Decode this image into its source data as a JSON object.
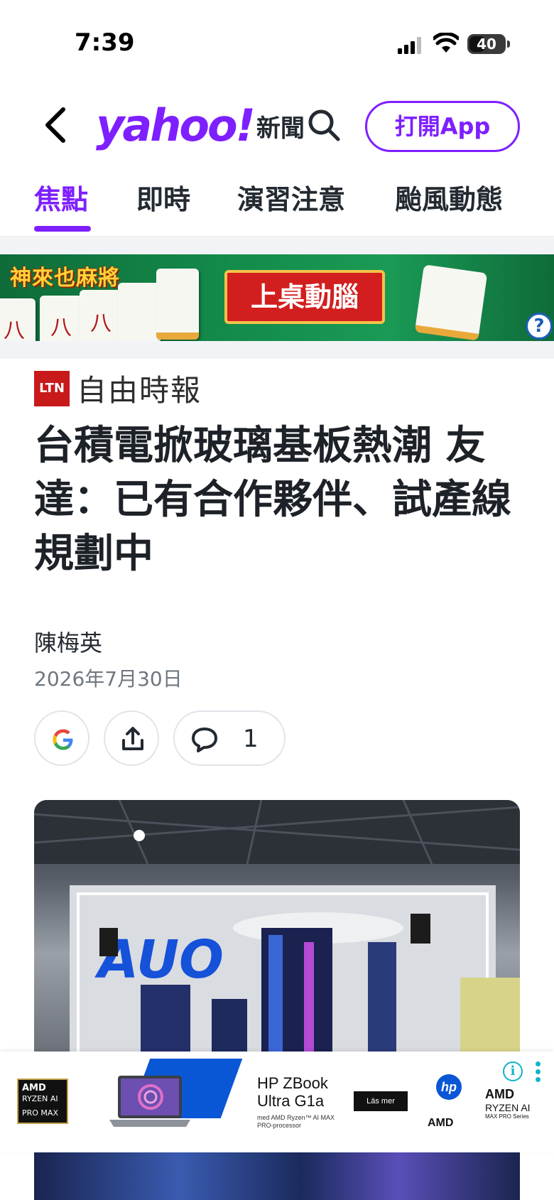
{
  "status_bar": {
    "time": "7:39",
    "battery": "40"
  },
  "header": {
    "brand_logo": "yahoo!",
    "brand_section": "新聞",
    "open_app_label": "打開App",
    "icons": [
      "chevron-left-icon",
      "search-icon"
    ],
    "accent_color": "#7e1fff"
  },
  "tabs": [
    {
      "label": "焦點",
      "active": true
    },
    {
      "label": "即時",
      "active": false
    },
    {
      "label": "演習注意",
      "active": false
    },
    {
      "label": "颱風動態",
      "active": false
    }
  ],
  "banner_ad": {
    "game_name": "神來也麻將",
    "cta": "上桌動腦",
    "tile_chars": [
      "八",
      "八",
      "八"
    ],
    "help_label": "?"
  },
  "article": {
    "source_badge": "LTN",
    "source_name": "自由時報",
    "title": "台積電掀玻璃基板熱潮 友達：已有合作夥伴、試產線規劃中",
    "author": "陳梅英",
    "date": "2026年7月30日",
    "comment_count": "1",
    "action_icons": [
      "google-icon",
      "share-icon",
      "comment-icon"
    ],
    "hero_image_text": "AUO"
  },
  "bottom_ad": {
    "amd_badge_line1": "AMD",
    "amd_badge_line2": "RYZEN AI",
    "amd_badge_line3": "PRO MAX",
    "product_line1": "HP ZBook",
    "product_line2": "Ultra G1a",
    "fine_print": "med AMD Ryzen™ AI MAX PRO-processor",
    "cta": "Läs mer",
    "hp_logo": "hp",
    "amd_mid": "AMD",
    "amd_right_line1": "AMD",
    "amd_right_line2": "RYZEN AI",
    "amd_right_line3": "MAX PRO Series",
    "info_label": "i"
  }
}
